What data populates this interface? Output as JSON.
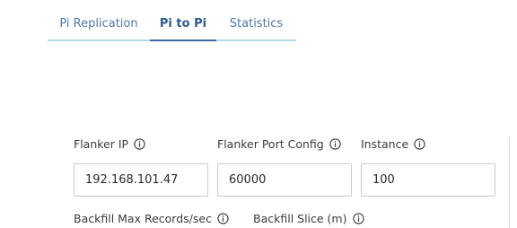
{
  "tabs": [
    {
      "label": "Pi Replication",
      "active": false
    },
    {
      "label": "Pi to Pi",
      "active": true
    },
    {
      "label": "Statistics",
      "active": false
    }
  ],
  "form": {
    "flanker_ip": {
      "label": "Flanker IP",
      "value": "192.168.101.47",
      "icon": "info-icon"
    },
    "flanker_port_config": {
      "label": "Flanker Port Config",
      "value": "60000",
      "icon": "info-icon"
    },
    "instance": {
      "label": "Instance",
      "value": "100",
      "icon": "info-icon"
    },
    "backfill_max_records": {
      "label": "Backfill Max Records/sec",
      "icon": "info-icon"
    },
    "backfill_slice": {
      "label": "Backfill Slice (m)",
      "icon": "info-icon"
    }
  },
  "colors": {
    "tab_text": "#4f79a8",
    "tab_active_text": "#2f5a8b",
    "tab_underline": "#b4dbe3",
    "tab_active_underline": "#3b6aa0",
    "field_border": "#c8ccd2"
  }
}
